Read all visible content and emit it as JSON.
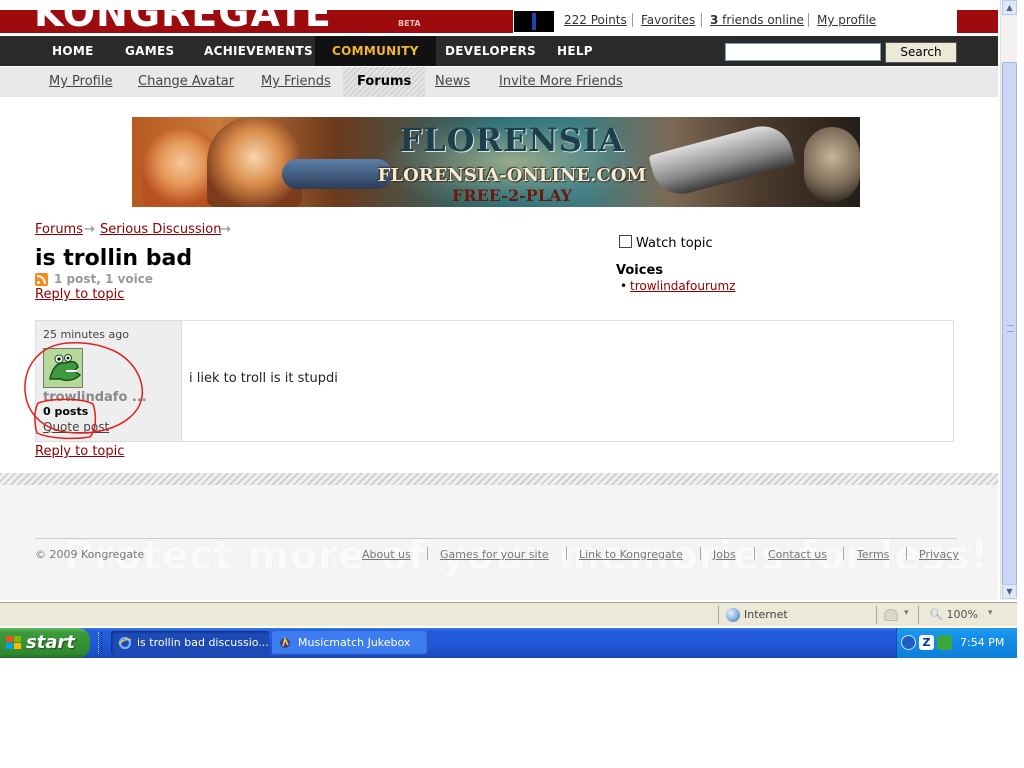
{
  "site": {
    "logo_text": "KONGREGATE",
    "beta": "BETA",
    "close_glyph": "×"
  },
  "userbar": {
    "points": "222 Points",
    "favorites": "Favorites",
    "friends_count": "3",
    "friends_online": " friends online",
    "my_profile": "My profile"
  },
  "mainnav": {
    "items": [
      "HOME",
      "GAMES",
      "ACHIEVEMENTS",
      "COMMUNITY",
      "DEVELOPERS",
      "HELP"
    ],
    "active": "COMMUNITY",
    "search_button": "Search",
    "search_value": ""
  },
  "subnav": {
    "items": [
      "My Profile",
      "Change Avatar",
      "My Friends",
      "Forums",
      "News",
      "Invite More Friends"
    ],
    "active": "Forums"
  },
  "banner": {
    "title": "FLORENSIA",
    "url": "FLORENSIA-ONLINE.COM",
    "tagline": "FREE-2-PLAY"
  },
  "breadcrumb": {
    "items": [
      "Forums",
      "Serious Discussion"
    ],
    "separator": "→"
  },
  "topic": {
    "title": "is trollin bad",
    "meta": "1 post, 1 voice",
    "reply_link": "Reply to topic"
  },
  "sidebar": {
    "watch_label": "Watch topic",
    "voices_title": "Voices",
    "voices": [
      "trowlindafourumz"
    ]
  },
  "post": {
    "time": "25 minutes ago",
    "author": "trowlindafo ...",
    "post_count": "0 posts",
    "quote_link": "Quote post",
    "body": "i liek to troll is it stupdi"
  },
  "footer": {
    "copyright": "© 2009 Kongregate",
    "links": [
      "About us",
      "Games for your site",
      "Link to Kongregate",
      "Jobs",
      "Contact us",
      "Terms",
      "Privacy"
    ],
    "watermark": "Protect more of your memories for less!"
  },
  "statusbar": {
    "zone": "Internet",
    "zoom": "100%",
    "dropdown_glyph": "▾"
  },
  "taskbar": {
    "start": "start",
    "tasks": [
      "is trollin bad discussio...",
      "Musicmatch Jukebox"
    ],
    "clock": "7:54 PM"
  },
  "scrollbar": {
    "up_glyph": "▲",
    "down_glyph": "▼"
  },
  "colors": {
    "brand_red": "#9e0b0f",
    "nav_dark": "#2b2b2b",
    "nav_active_text": "#f2b632",
    "link_red": "#8b0000",
    "xp_taskbar": "#245edb",
    "xp_start_green": "#3b9a3b",
    "annotation_red": "#e02020"
  }
}
